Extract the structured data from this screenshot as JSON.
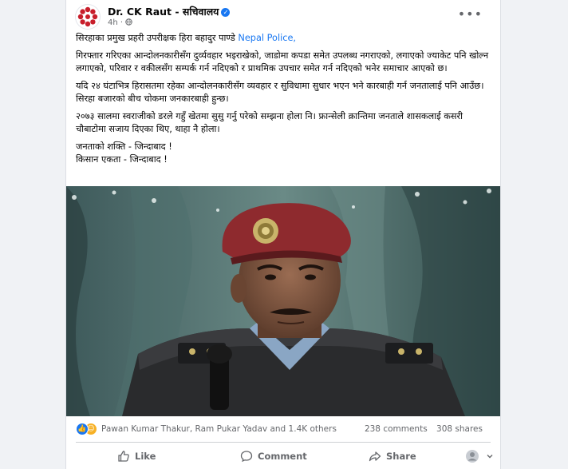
{
  "post": {
    "author": "Dr. CK Raut - सचिवालय",
    "time": "4h",
    "privacy_icon": "globe-icon",
    "more_icon": "more-options-icon",
    "paragraphs": [
      {
        "text": "सिरहाका प्रमुख प्रहरी उपरीक्षक हिरा बहादुर पाण्डे ",
        "link": "Nepal Police,"
      },
      {
        "text": "गिरफ्तार गरिएका आन्दोलनकारीसँग दुर्व्यवहार भइराखेको, जाडोमा कपडा समेत उपलब्ध नगराएको, लगाएको ज्याकेट पनि खोल्न लगाएको, परिवार र वकीलसँग सम्पर्क गर्न नदिएको र प्राथमिक उपचार समेत गर्न नदिएको भनेर समाचार आएको छ।"
      },
      {
        "text": "यदि २४ घंटाभित्र हिरासतमा रहेका आन्दोलनकारीसँग व्यवहार र सुविधामा सुधार भएन भने कारबाही गर्न जनतालाई पनि आउँछ। सिरहा बजारको बीच चोकमा जनकारबाही हुन्छ।"
      },
      {
        "text": "२०७३ सालमा स्वराजीको डरले गहुँ खेतमा सुसु गर्नु परेको सम्झना होला नि। फ्रान्सेली क्रान्तिमा जनताले  शासकलाई कसरी चौबाटोमा सजाय दिएका थिए, थाहा नै होला।"
      },
      {
        "lines": [
          "जनताको शक्ति - जिन्दाबाद !",
          "किसान एकता - जिन्दाबाद !"
        ]
      }
    ]
  },
  "stats": {
    "reactors": "Pawan Kumar Thakur, Ram Pukar Yadav and 1.4K others",
    "comments": "238 comments",
    "shares": "308 shares"
  },
  "actions": {
    "like": "Like",
    "comment": "Comment",
    "share": "Share"
  },
  "colors": {
    "link": "#1877f2",
    "muted": "#65676b",
    "beret": "#8e2a2e"
  }
}
